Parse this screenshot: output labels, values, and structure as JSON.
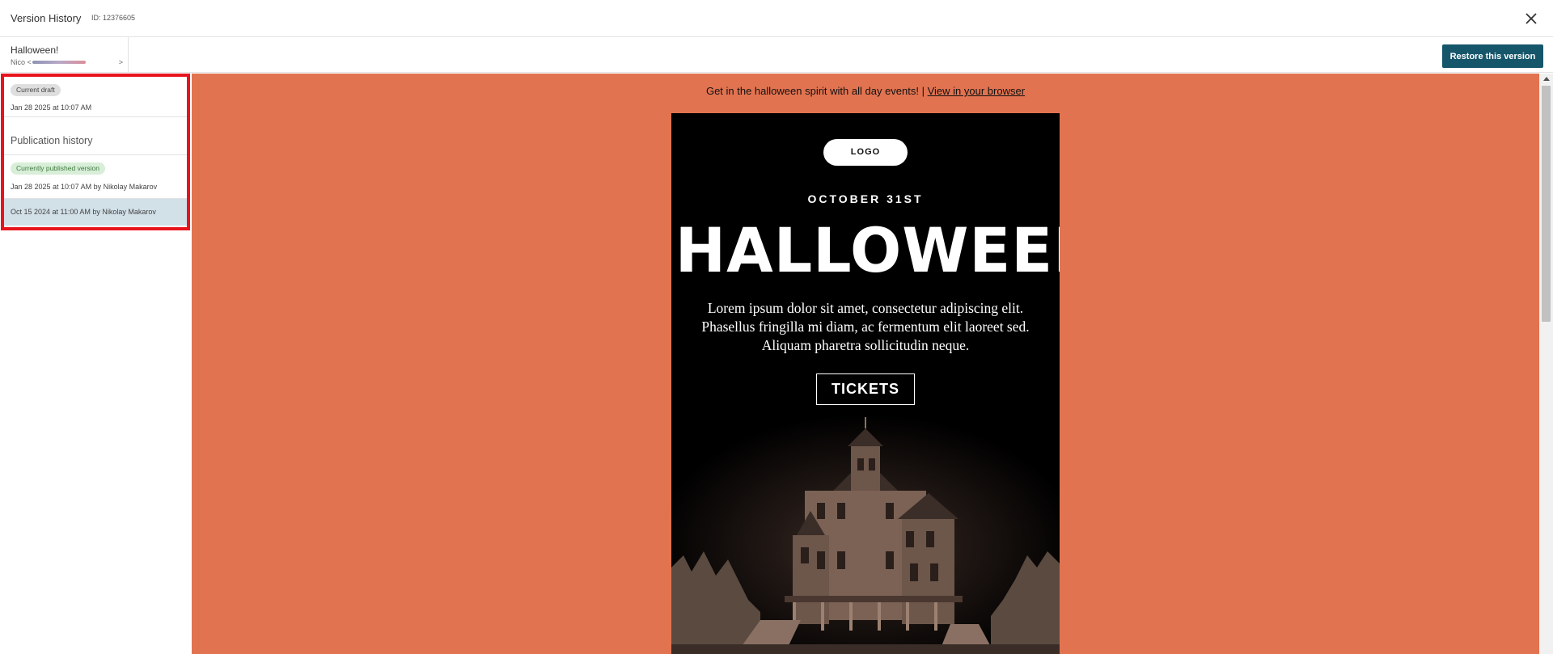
{
  "header": {
    "title": "Version History",
    "id_label": "ID: 12376605",
    "close_icon": "close-icon"
  },
  "campaign": {
    "name": "Halloween!",
    "sender_prefix": "Nico <",
    "sender_suffix": ">"
  },
  "toolbar": {
    "restore_label": "Restore this version"
  },
  "sidebar": {
    "current_draft": {
      "badge": "Current draft",
      "timestamp": "Jan 28 2025 at 10:07 AM"
    },
    "publication_history_heading": "Publication history",
    "versions": [
      {
        "badge": "Currently published version",
        "timestamp": "Jan 28 2025 at 10:07 AM by Nikolay Makarov",
        "selected": false
      },
      {
        "badge": "",
        "timestamp": "Oct 15 2024 at 11:00 AM by Nikolay Makarov",
        "selected": true
      }
    ]
  },
  "preview": {
    "preheader_text": "Get in the halloween spirit with all day events!  |",
    "preheader_link": "View in your browser",
    "logo_label": "LOGO",
    "date_text": "OCTOBER 31ST",
    "headline": "HALLOWEEN",
    "body_lines": [
      "Lorem ipsum dolor sit amet, consectetur adipiscing elit.",
      "Phasellus fringilla mi diam, ac fermentum elit laoreet sed.",
      "Aliquam pharetra sollicitudin neque."
    ],
    "cta_label": "TICKETS",
    "image": "haunted-house-image"
  },
  "colors": {
    "accent": "#16566b",
    "preview_background": "#e27350",
    "highlight_border": "#e8141d",
    "selected_row": "#d2e0e8"
  }
}
